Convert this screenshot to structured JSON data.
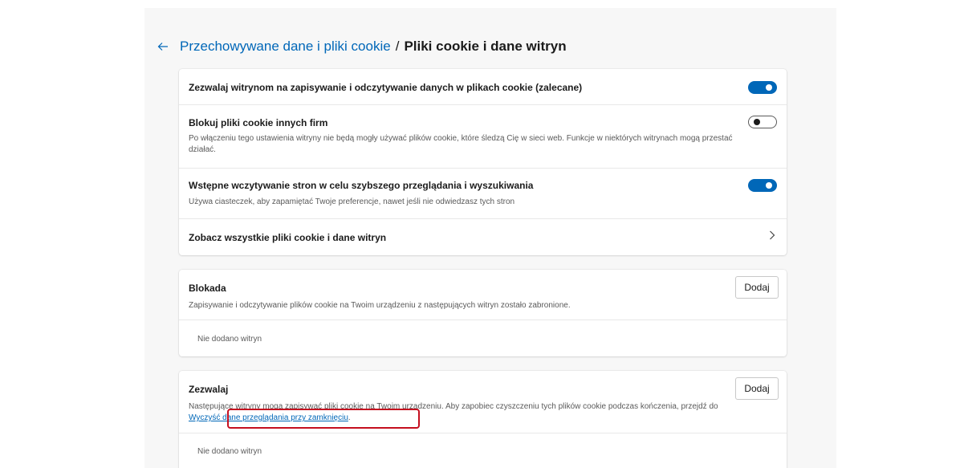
{
  "header": {
    "parent_link": "Przechowywane dane i pliki cookie",
    "separator": "/",
    "current": "Pliki cookie i dane witryn"
  },
  "settings": {
    "allow_cookies": {
      "title": "Zezwalaj witrynom na zapisywanie i odczytywanie danych w plikach cookie (zalecane)",
      "enabled": true
    },
    "block_third_party": {
      "title": "Blokuj pliki cookie innych firm",
      "desc": "Po włączeniu tego ustawienia witryny nie będą mogły używać plików cookie, które śledzą Cię w sieci web. Funkcje w niektórych witrynach mogą przestać działać.",
      "enabled": false
    },
    "preload": {
      "title": "Wstępne wczytywanie stron w celu szybszego przeglądania i wyszukiwania",
      "desc": "Używa ciasteczek, aby zapamiętać Twoje preferencje, nawet jeśli nie odwiedzasz tych stron",
      "enabled": true
    },
    "see_all": {
      "title": "Zobacz wszystkie pliki cookie i dane witryn"
    }
  },
  "block": {
    "title": "Blokada",
    "desc": "Zapisywanie i odczytywanie plików cookie na Twoim urządzeniu z następujących witryn zostało zabronione.",
    "add_label": "Dodaj",
    "empty": "Nie dodano witryn"
  },
  "allow": {
    "title": "Zezwalaj",
    "desc_part1": "Następujące witryny mogą zapisywać pliki cookie na Twoim urządzeniu. Aby zapobiec czyszczeniu tych plików cookie podczas kończenia, przejdź do ",
    "desc_link": "Wyczyść dane przeglądania przy zamknięciu",
    "desc_end": ".",
    "add_label": "Dodaj",
    "empty": "Nie dodano witryn"
  },
  "colors": {
    "accent": "#0067b8",
    "highlight": "#c50f1f",
    "backdrop": "#f7f7f7"
  },
  "icons": {
    "back": "arrow-left-icon",
    "chevron": "chevron-right-icon"
  }
}
